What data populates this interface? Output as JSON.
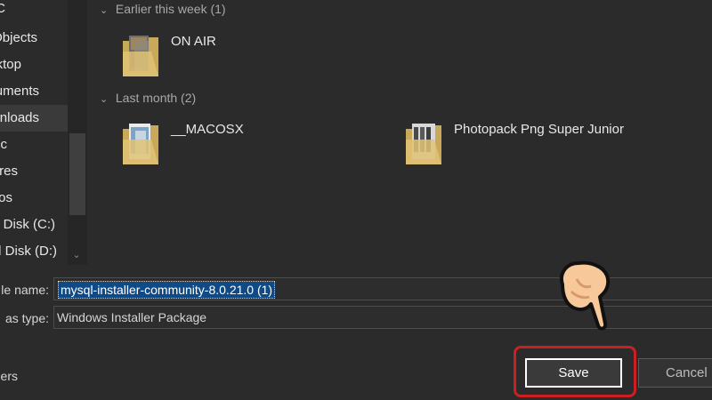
{
  "nav": {
    "items": [
      {
        "label": "C"
      },
      {
        "label": "Objects"
      },
      {
        "label": "ktop"
      },
      {
        "label": "uments"
      },
      {
        "label": "nloads",
        "selected": true
      },
      {
        "label": "ic"
      },
      {
        "label": "ures"
      },
      {
        "label": "os"
      },
      {
        "label": "l Disk (C:)"
      },
      {
        "label": "l Disk (D:)"
      }
    ]
  },
  "groups": [
    {
      "header": "Earlier this week (1)",
      "folders": [
        {
          "name": "ON AIR"
        }
      ]
    },
    {
      "header": "Last month (2)",
      "folders": [
        {
          "name": "__MACOSX"
        },
        {
          "name": "Photopack Png Super Junior"
        }
      ]
    }
  ],
  "form": {
    "filename_label": "le name:",
    "filename_value": "mysql-installer-community-8.0.21.0 (1)",
    "type_label": "as type:",
    "type_value": "Windows Installer Package",
    "hide_folders_label": "lers"
  },
  "buttons": {
    "save": "Save",
    "cancel": "Cancel"
  },
  "colors": {
    "background": "#2b2b2b",
    "selection": "#0f4a86",
    "highlight_ring": "#cc1f22"
  }
}
